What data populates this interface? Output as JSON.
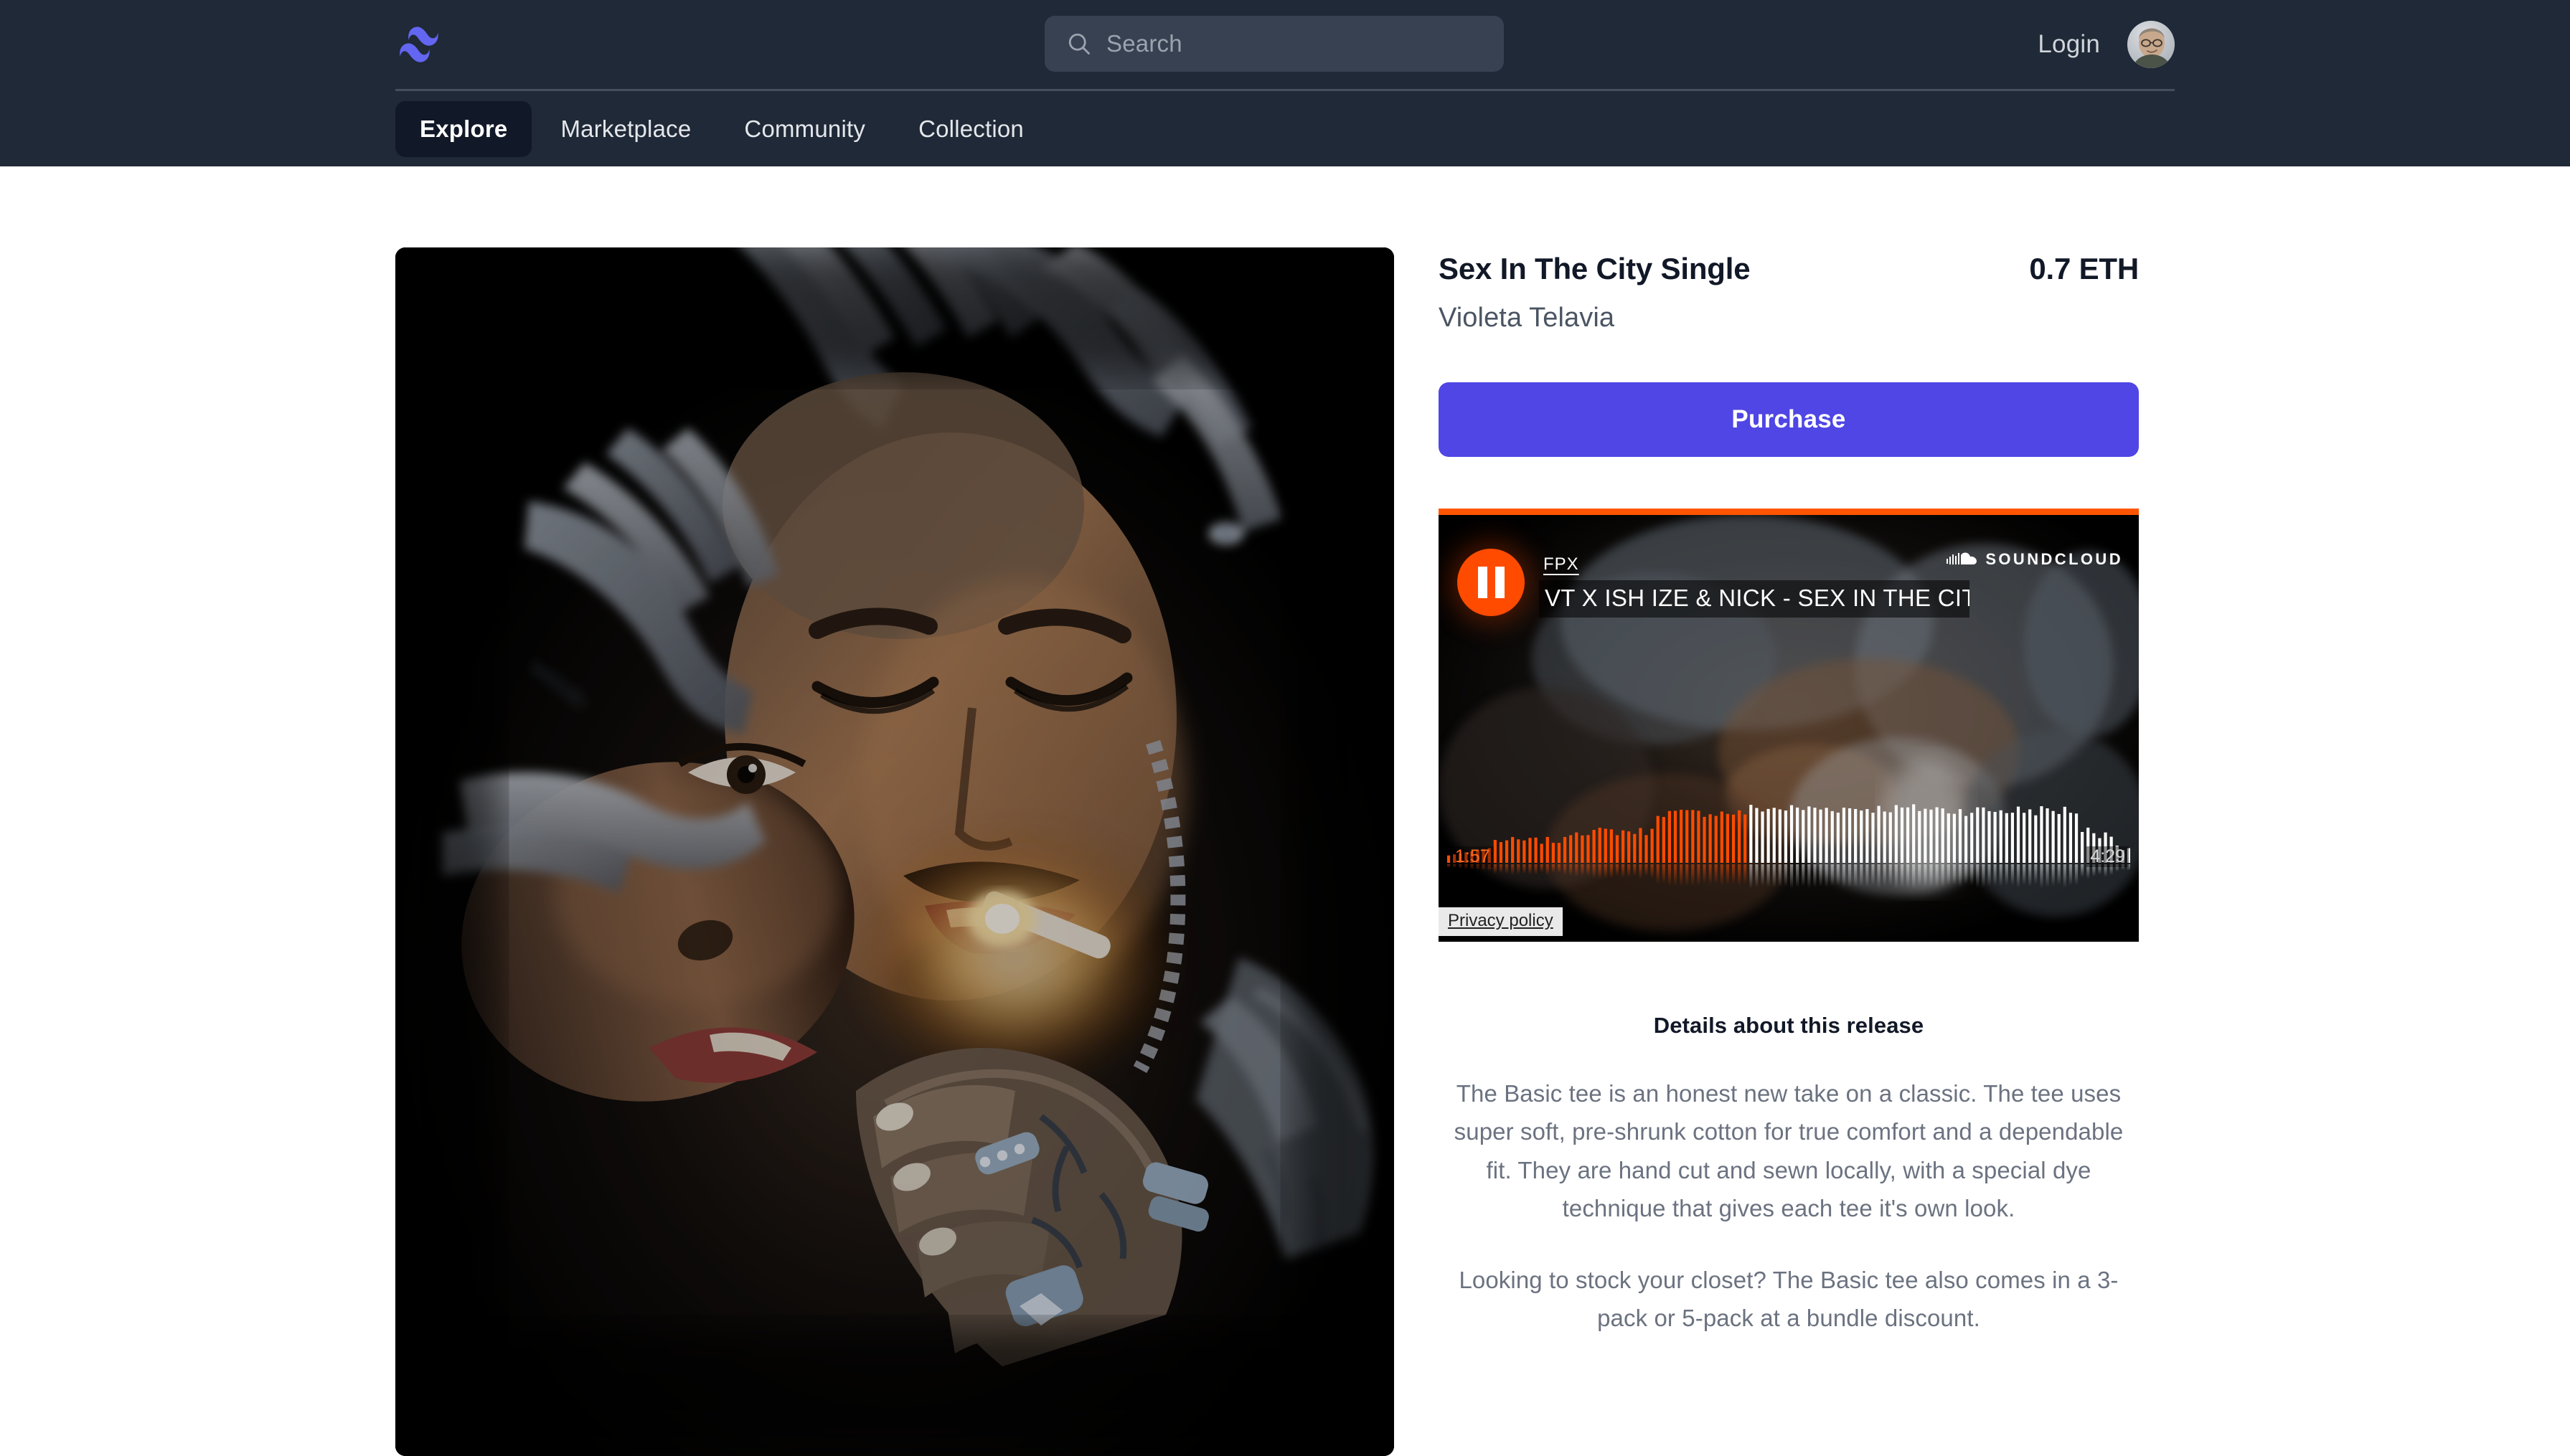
{
  "header": {
    "logo_icon": "tailwind-wave-logo",
    "search": {
      "placeholder": "Search",
      "value": "",
      "icon": "search-icon"
    },
    "login_label": "Login",
    "avatar_alt": "user-avatar",
    "nav": [
      {
        "label": "Explore",
        "active": true
      },
      {
        "label": "Marketplace",
        "active": false
      },
      {
        "label": "Community",
        "active": false
      },
      {
        "label": "Collection",
        "active": false
      }
    ]
  },
  "product": {
    "artwork_alt": "sex-in-the-city-single-cover-art",
    "title": "Sex In The City Single",
    "price": "0.7 ETH",
    "artist": "Violeta Telavia",
    "purchase_label": "Purchase"
  },
  "player": {
    "provider": "SoundCloud",
    "provider_wordmark": "SOUNDCLOUD",
    "provider_icon": "soundcloud-cloud-icon",
    "transport_icon": "pause-icon",
    "transport_state": "playing",
    "artist": "FPX",
    "track": "VT X ISH IZE & NICK - SEX IN THE CITY (M...",
    "current_time": "1:57",
    "duration": "4:29",
    "progress_percent": 44,
    "privacy_label": "Privacy policy",
    "accent_color": "#ff5500"
  },
  "details": {
    "heading": "Details about this release",
    "paragraphs": [
      "The Basic tee is an honest new take on a classic. The tee uses super soft, pre-shrunk cotton for true comfort and a dependable fit. They are hand cut and sewn locally, with a special dye technique that gives each tee it's own look.",
      "Looking to stock your closet? The Basic tee also comes in a 3-pack or 5-pack at a bundle discount."
    ]
  },
  "colors": {
    "header_bg": "#1f2937",
    "active_tab_bg": "#111827",
    "accent_purple": "#4f46e5",
    "soundcloud_orange": "#ff5500",
    "page_bg": "#ffffff",
    "body_text": "#6b7280"
  }
}
